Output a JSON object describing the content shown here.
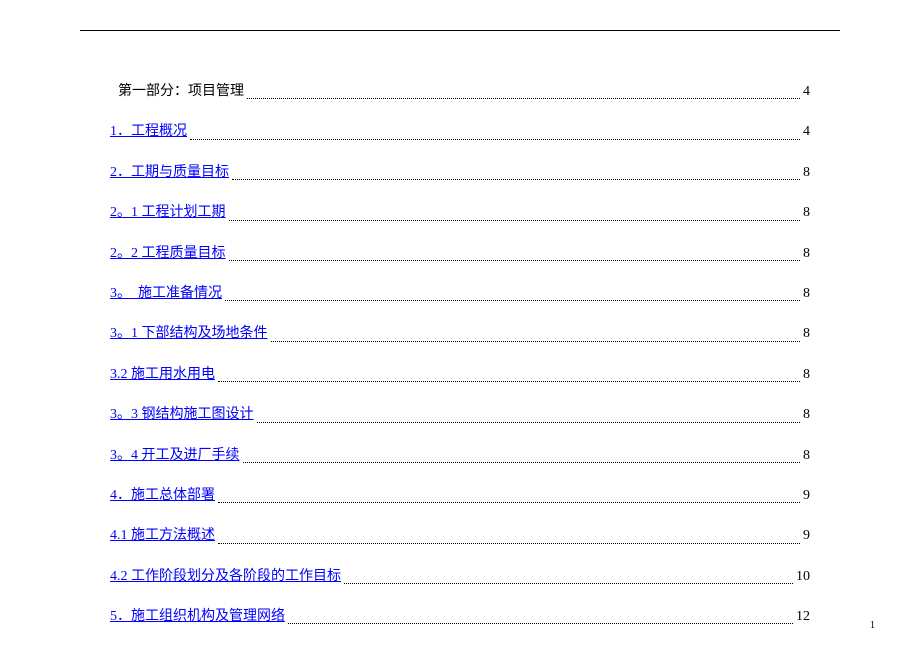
{
  "toc": [
    {
      "title": "第一部分：项目管理",
      "page": "4",
      "link": false,
      "indent": true
    },
    {
      "title": "1．工程概况",
      "page": "4",
      "link": true,
      "indent": false
    },
    {
      "title": "2．工期与质量目标",
      "page": "8",
      "link": true,
      "indent": false
    },
    {
      "title": "2。1 工程计划工期",
      "page": "8",
      "link": true,
      "indent": false
    },
    {
      "title": "2。2 工程质量目标",
      "page": "8",
      "link": true,
      "indent": false
    },
    {
      "title": "3。　施工准备情况",
      "page": "8",
      "link": true,
      "indent": false
    },
    {
      "title": "3。1 下部结构及场地条件",
      "page": "8",
      "link": true,
      "indent": false
    },
    {
      "title": "3.2 施工用水用电",
      "page": "8",
      "link": true,
      "indent": false
    },
    {
      "title": "3。3 钢结构施工图设计",
      "page": "8",
      "link": true,
      "indent": false
    },
    {
      "title": "3。4 开工及进厂手续",
      "page": "8",
      "link": true,
      "indent": false
    },
    {
      "title": "4．施工总体部署",
      "page": "9",
      "link": true,
      "indent": false
    },
    {
      "title": "4.1 施工方法概述",
      "page": "9",
      "link": true,
      "indent": false
    },
    {
      "title": "4.2 工作阶段划分及各阶段的工作目标",
      "page": "10",
      "link": true,
      "indent": false
    },
    {
      "title": "5．施工组织机构及管理网络",
      "page": "12",
      "link": true,
      "indent": false
    }
  ],
  "pageNumber": "1"
}
